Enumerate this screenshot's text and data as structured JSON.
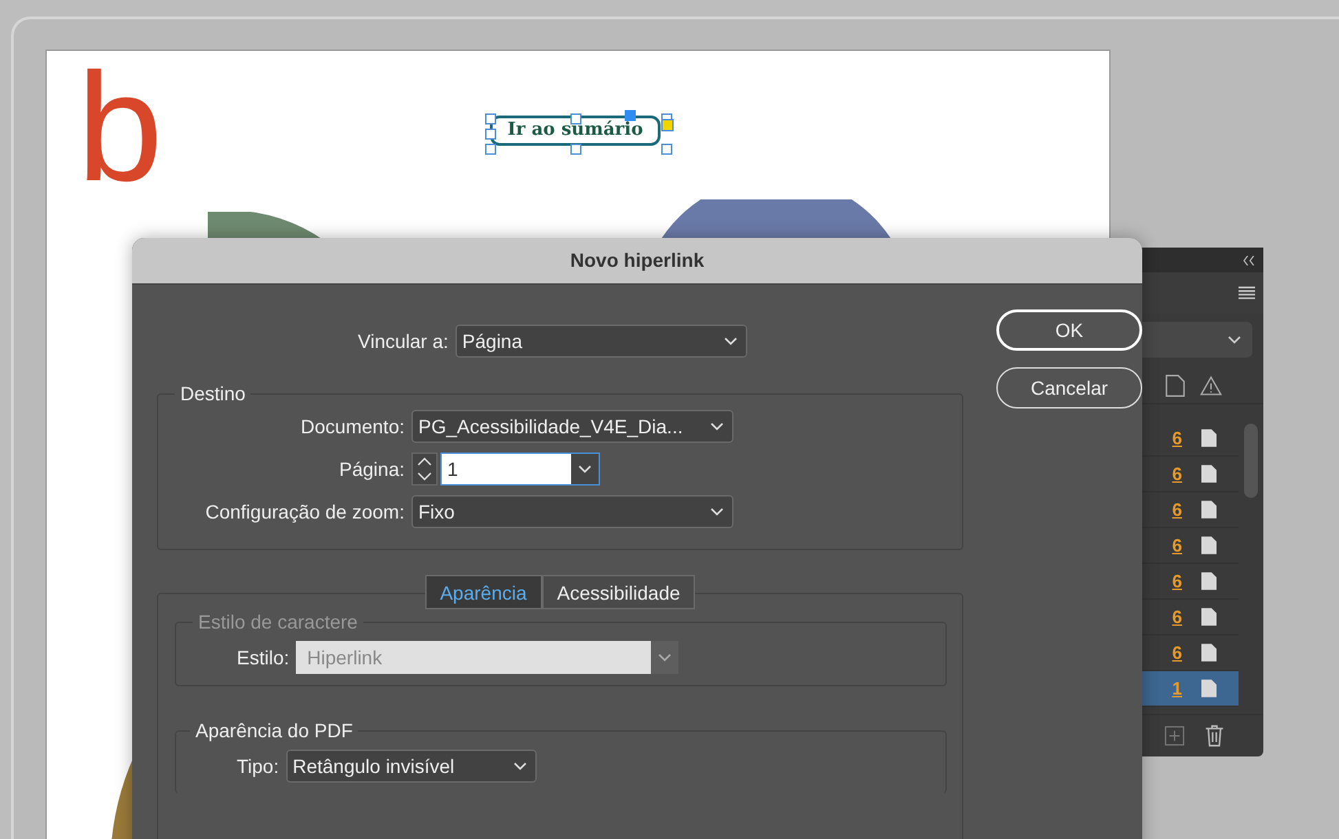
{
  "document": {
    "letter": "b",
    "link_text": "Ir ao sumário"
  },
  "dialog": {
    "title": "Novo hiperlink",
    "link_to": {
      "label": "Vincular a:",
      "value": "Página"
    },
    "buttons": [
      "OK",
      "Cancelar"
    ],
    "destination": {
      "title": "Destino",
      "fields": [
        {
          "kind": "select",
          "label": "Documento:",
          "value": "PG_Acessibilidade_V4E_Dia..."
        },
        {
          "kind": "spinner",
          "label": "Página:",
          "value": "1"
        },
        {
          "kind": "select",
          "label": "Configuração de zoom:",
          "value": "Fixo"
        }
      ]
    },
    "tabs": [
      {
        "label": "Aparência",
        "selected": true
      },
      {
        "label": "Acessibilidade",
        "selected": false
      }
    ],
    "char_style": {
      "title": "Estilo de caractere",
      "disabled": true,
      "label": "Estilo:",
      "value": "Hiperlink"
    },
    "pdf_appearance": {
      "title": "Aparência do PDF",
      "label": "Tipo:",
      "value": "Retângulo invisível"
    }
  },
  "panel": {
    "rows": [
      {
        "page": "6",
        "selected": false
      },
      {
        "page": "6",
        "selected": false
      },
      {
        "page": "6",
        "selected": false
      },
      {
        "page": "6",
        "selected": false
      },
      {
        "page": "6",
        "selected": false
      },
      {
        "page": "6",
        "selected": false
      },
      {
        "page": "6",
        "selected": false
      },
      {
        "page": "1",
        "selected": true
      }
    ]
  }
}
